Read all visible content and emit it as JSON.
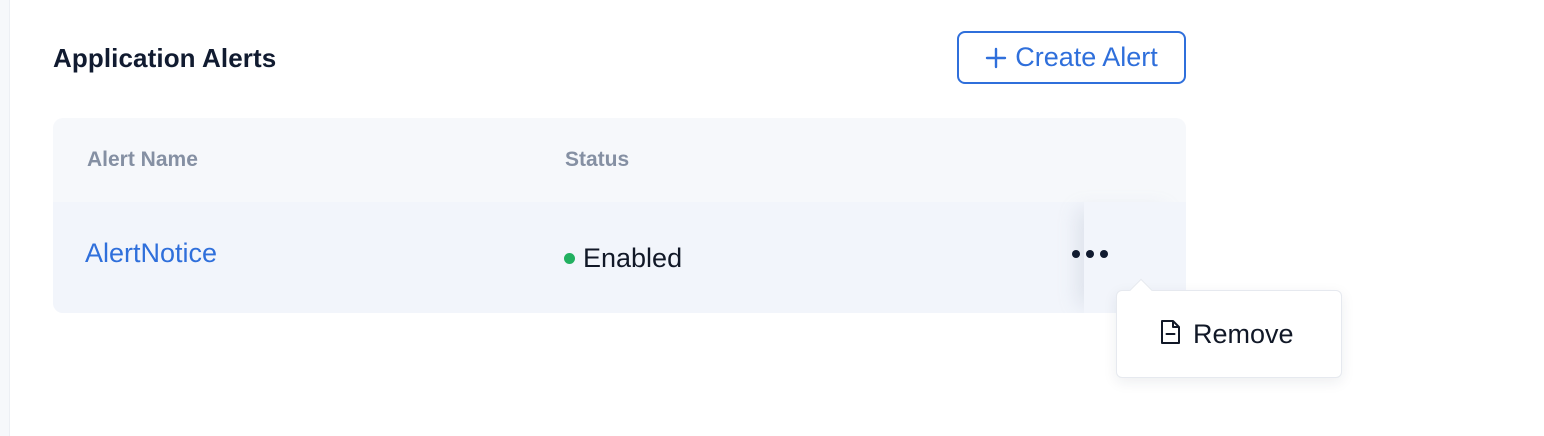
{
  "section": {
    "title": "Application Alerts"
  },
  "toolbar": {
    "create_label": "Create Alert",
    "create_icon": "plus-icon"
  },
  "table": {
    "columns": [
      "Alert Name",
      "Status"
    ],
    "rows": [
      {
        "name": "AlertNotice",
        "status": "Enabled",
        "status_color": "#22b060"
      }
    ]
  },
  "row_menu": {
    "trigger_icon": "more-horizontal-icon",
    "items": [
      {
        "label": "Remove",
        "icon": "file-minus-icon"
      }
    ]
  },
  "colors": {
    "accent": "#2f6fdb",
    "heading": "#111b30",
    "muted": "#8590a3",
    "table_bg": "#f6f8fb"
  }
}
